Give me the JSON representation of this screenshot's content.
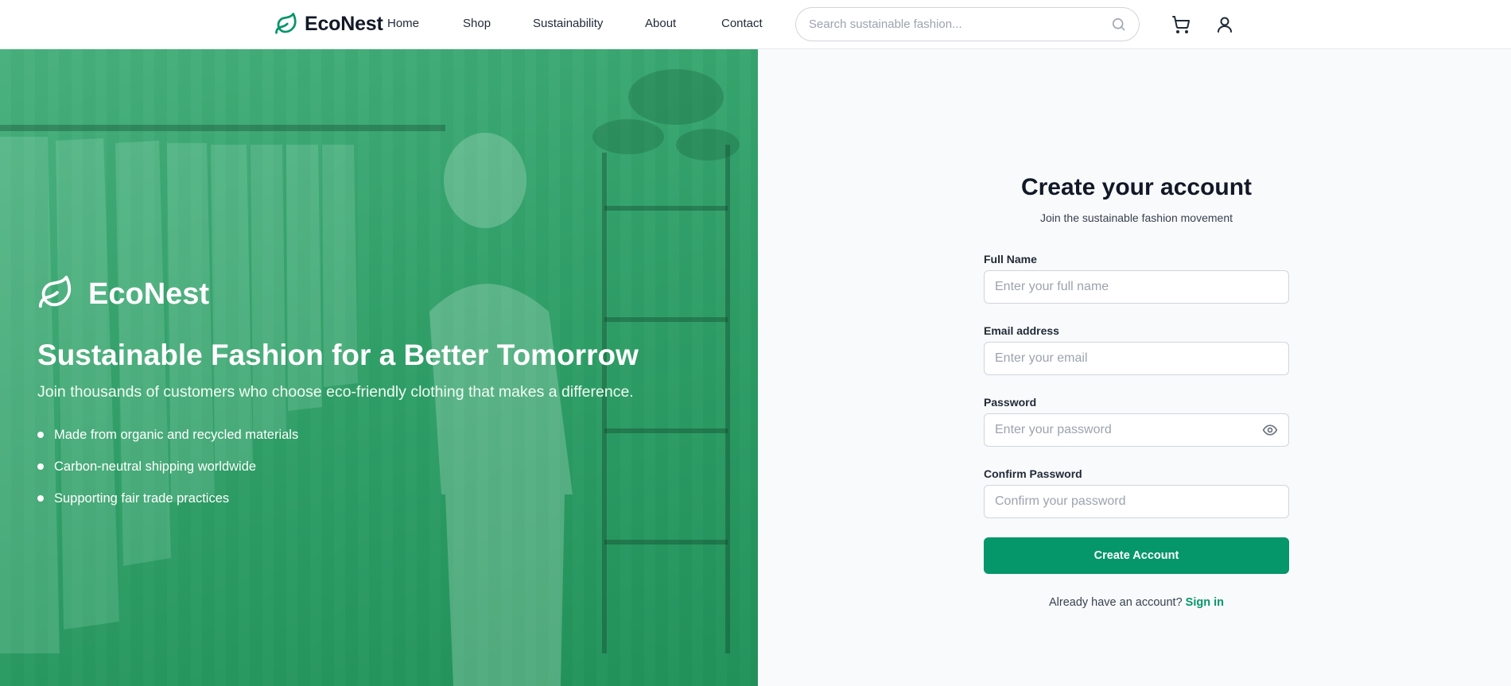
{
  "header": {
    "brand": "EcoNest",
    "nav": [
      "Home",
      "Shop",
      "Sustainability",
      "About",
      "Contact"
    ],
    "search_placeholder": "Search sustainable fashion...",
    "icons": {
      "search": "search-icon",
      "cart": "cart-icon",
      "account": "user-icon",
      "logo": "leaf-icon"
    }
  },
  "hero": {
    "brand": "EcoNest",
    "title": "Sustainable Fashion for a Better Tomorrow",
    "subtitle": "Join thousands of customers who choose eco-friendly clothing that makes a difference.",
    "features": [
      "Made from organic and recycled materials",
      "Carbon-neutral shipping worldwide",
      "Supporting fair trade practices"
    ]
  },
  "form": {
    "title": "Create your account",
    "subtitle": "Join the sustainable fashion movement",
    "fields": {
      "full_name": {
        "label": "Full Name",
        "placeholder": "Enter your full name",
        "value": ""
      },
      "email": {
        "label": "Email address",
        "placeholder": "Enter your email",
        "value": ""
      },
      "password": {
        "label": "Password",
        "placeholder": "Enter your password",
        "value": ""
      },
      "confirm_password": {
        "label": "Confirm Password",
        "placeholder": "Confirm your password",
        "value": ""
      }
    },
    "submit_label": "Create Account",
    "signin_prompt": "Already have an account?",
    "signin_link": "Sign in"
  },
  "colors": {
    "accent": "#059669",
    "hero_overlay": "#22965c",
    "form_bg": "#f9fafb"
  }
}
